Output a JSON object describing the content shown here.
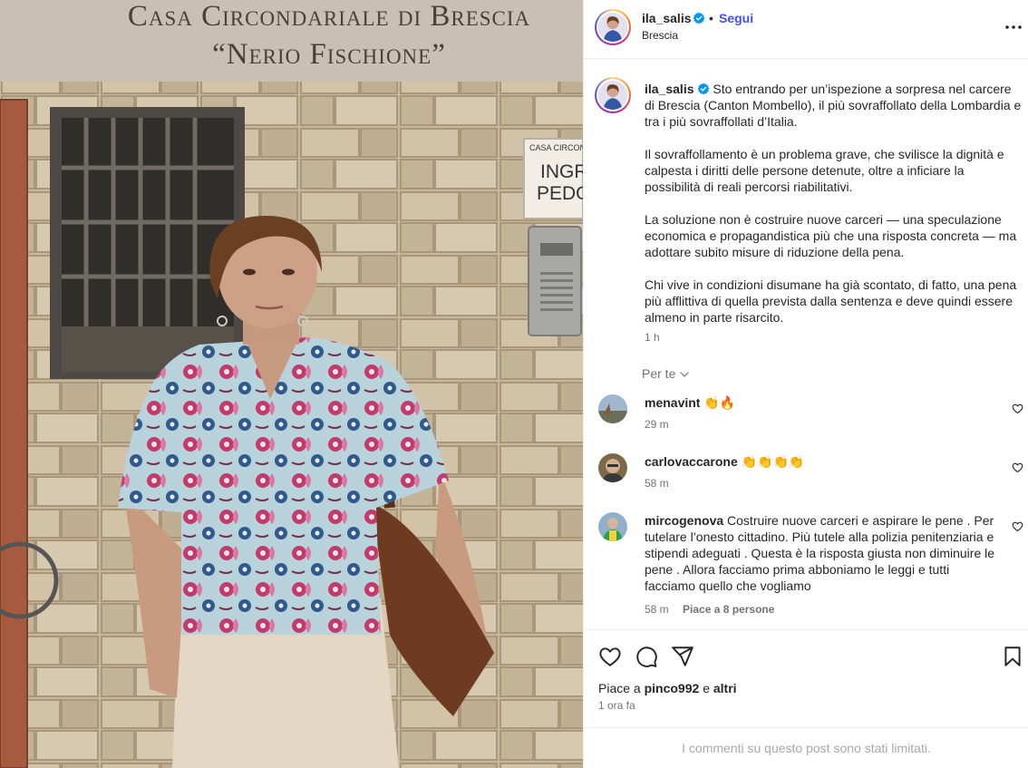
{
  "photo": {
    "sign_line1": "Casa Circondariale di Brescia",
    "sign_line2": "“Nerio Fischione”",
    "small_sign_line1": "CASA CIRCONDARI",
    "small_sign_line2": "INGR",
    "small_sign_line3": "PEDO"
  },
  "header": {
    "username": "ila_salis",
    "dot": "•",
    "follow_label": "Segui",
    "location": "Brescia"
  },
  "caption": {
    "username": "ila_salis",
    "paragraphs": [
      "Sto entrando per un’ispezione a sorpresa nel carcere di Brescia (Canton Mombello), il più sovraffollato della Lombardia e tra i più sovraffollati d’Italia.",
      "Il sovraffollamento è un problema grave, che svilisce la dignità e calpesta i diritti delle persone detenute, oltre a inficiare la possibilità di reali percorsi riabilitativi.",
      "La soluzione non è costruire nuove carceri — una speculazione economica e propagandistica più che una risposta concreta — ma adottare subito misure di riduzione della pena.",
      "Chi vive in condizioni disumane ha già scontato, di fatto, una pena più afflittiva di quella prevista dalla sentenza e deve quindi essere almeno in parte risarcito."
    ],
    "time": "1 h"
  },
  "comments_filter": "Per te",
  "comments": [
    {
      "username": "menavint",
      "text": "👏🔥",
      "time": "29 m",
      "likes": ""
    },
    {
      "username": "carlovaccarone",
      "text": "👏👏👏👏",
      "time": "58 m",
      "likes": ""
    },
    {
      "username": "mircogenova",
      "text": "Costruire nuove carceri e aspirare le pene . Per tutelare l’onesto cittadino. Più tutele alla polizia penitenziaria e stipendi adeguati . Questa è la risposta giusta non diminuire le pene . Allora facciamo prima abboniamo le leggi e tutti facciamo quello che vogliamo",
      "time": "58 m",
      "likes": "Piace a 8 persone"
    }
  ],
  "actions": {
    "likes_prefix": "Piace a",
    "likes_user": "pinco992",
    "likes_and": "e",
    "likes_others": "altri",
    "post_time": "1 ora fa"
  },
  "footer": {
    "limited_comments": "I commenti su questo post sono stati limitati."
  },
  "colors": {
    "accent_link": "#4150f7",
    "verified": "#0095f6",
    "muted_text": "#737373"
  }
}
